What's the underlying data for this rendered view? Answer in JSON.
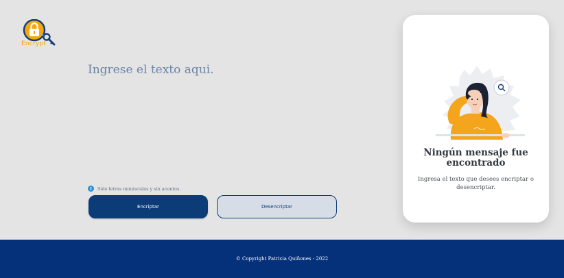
{
  "logo": {
    "text": "Encrypt",
    "icon": "padlock-key-icon"
  },
  "main": {
    "input_placeholder": "Ingrese el texto aqui.",
    "hint_icon": "!",
    "hint_text": "Sólo letras minúsculas y sin acentos.",
    "encrypt_label": "Encriptar",
    "decrypt_label": "Desencriptar"
  },
  "card": {
    "title": "Ningún mensaje fue encontrado",
    "subtitle": "Ingresa el texto que desees encriptar o desencriptar.",
    "illustration": "searching-woman-illustration"
  },
  "footer": {
    "text": "© Copyright Patricia Quiñones - 2022"
  },
  "colors": {
    "brand_blue": "#0b3c78",
    "footer_blue": "#05307a",
    "accent_orange": "#f2a20c"
  }
}
